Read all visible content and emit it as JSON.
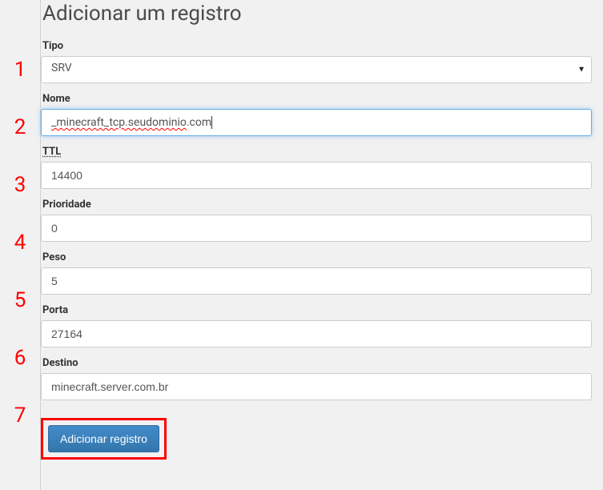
{
  "title": "Adicionar um registro",
  "numbers": [
    "1",
    "2",
    "3",
    "4",
    "5",
    "6",
    "7"
  ],
  "fields": {
    "tipo": {
      "label": "Tipo",
      "value": "SRV"
    },
    "nome": {
      "label": "Nome",
      "value_part1": "_minecraft_tcp.seudominio",
      "value_part2": ".com"
    },
    "ttl": {
      "label": "TTL",
      "value": "14400"
    },
    "prioridade": {
      "label": "Prioridade",
      "value": "0"
    },
    "peso": {
      "label": "Peso",
      "value": "5"
    },
    "porta": {
      "label": "Porta",
      "value": "27164"
    },
    "destino": {
      "label": "Destino",
      "value": "minecraft.server.com.br"
    }
  },
  "button": {
    "label": "Adicionar registro"
  }
}
